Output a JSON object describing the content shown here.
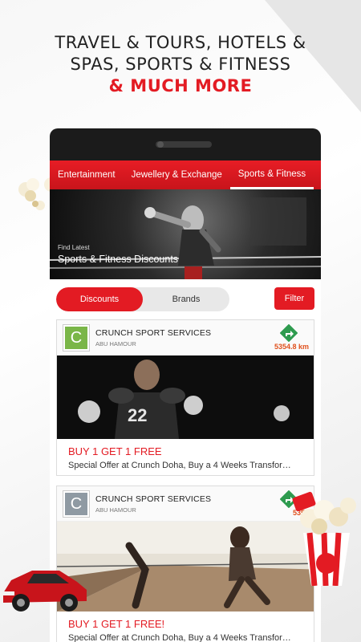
{
  "headline": {
    "line1": "TRAVEL & TOURS, HOTELS &",
    "line2": "SPAS, SPORTS & FITNESS",
    "line3": "& MUCH MORE"
  },
  "tabs": [
    {
      "label": "Entertainment"
    },
    {
      "label": "Jewellery & Exchange"
    },
    {
      "label": "Sports & Fitness"
    }
  ],
  "hero": {
    "small": "Find Latest",
    "big": "Sports & Fitness Discounts"
  },
  "segments": {
    "discounts": "Discounts",
    "brands": "Brands"
  },
  "filter_label": "Filter",
  "offers": [
    {
      "logo_letter": "C",
      "logo_color": "#7ab648",
      "merchant": "CRUNCH SPORT SERVICES",
      "area": "ABU HAMOUR",
      "distance": "5354.8 km",
      "title": "BUY 1 GET 1 FREE",
      "desc": "Special Offer at Crunch Doha, Buy a 4 Weeks Transfor…"
    },
    {
      "logo_letter": "C",
      "logo_color": "#8f9aa3",
      "merchant": "CRUNCH SPORT SERVICES",
      "area": "ABU HAMOUR",
      "distance": "5354",
      "title": "BUY 1 GET 1 FREE!",
      "desc": "Special Offer at Crunch Doha, Buy a 4 Weeks Transfor…"
    }
  ],
  "colors": {
    "accent": "#e31b23",
    "nav_green": "#2e9b4f",
    "distance": "#e0501c"
  },
  "icons": [
    "popcorn-icon",
    "navigate-arrow-icon",
    "car-icon"
  ]
}
